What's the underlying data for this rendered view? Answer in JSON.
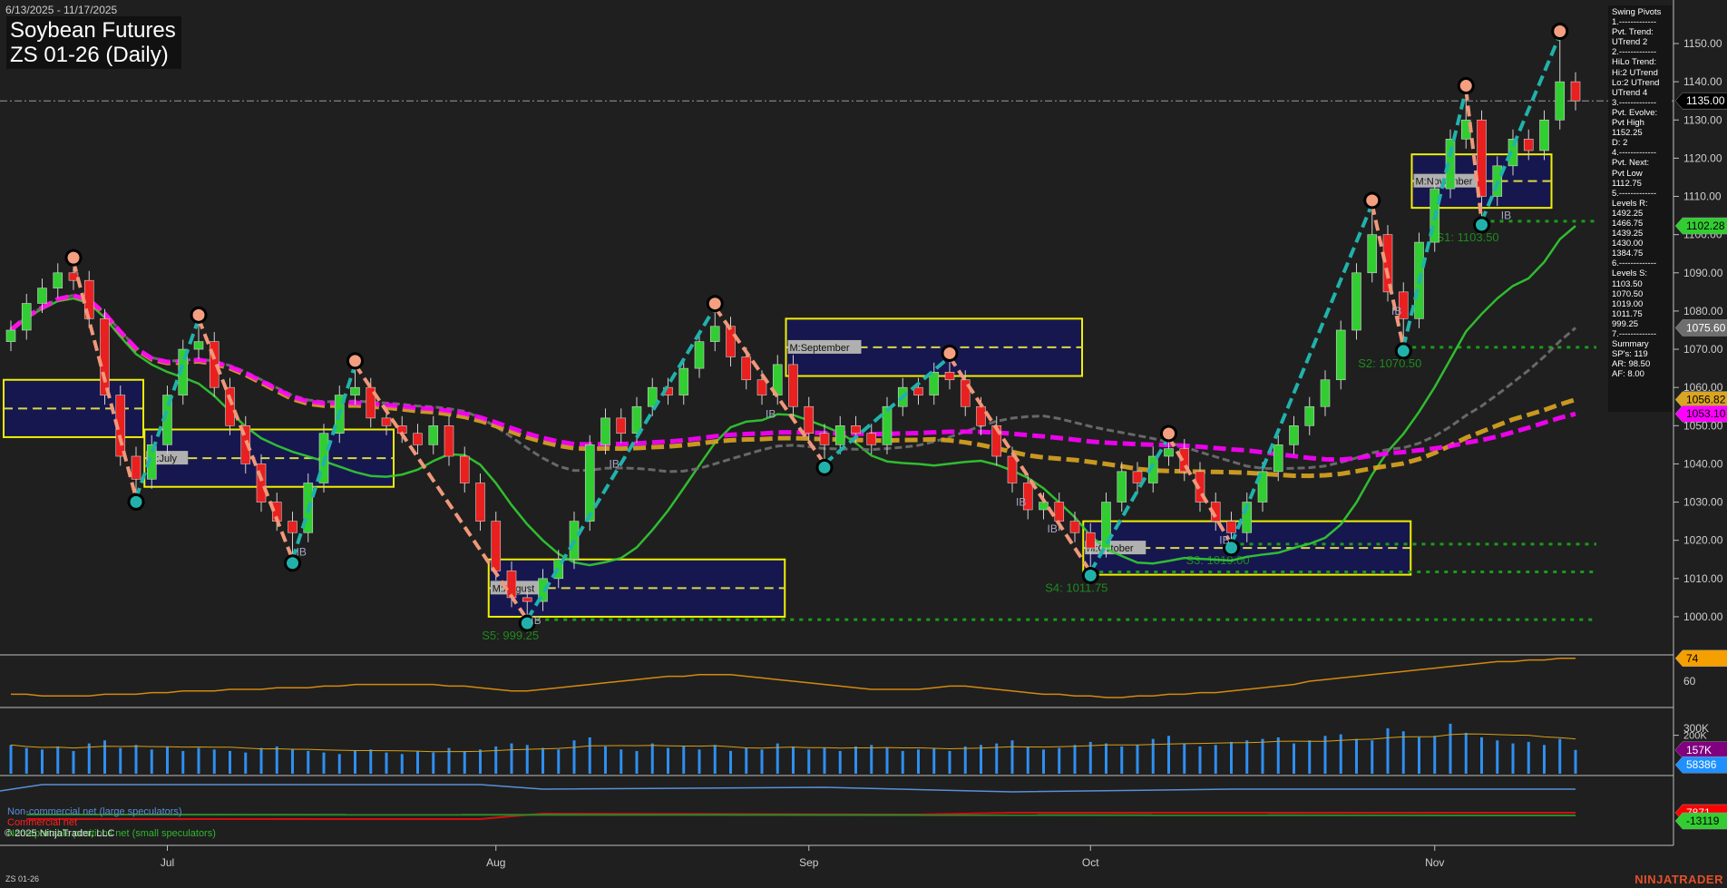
{
  "header": {
    "date_range": "6/13/2025 - 11/17/2025",
    "title": "Soybean Futures",
    "subtitle": "ZS 01-26 (Daily)"
  },
  "info_panel": {
    "lines": [
      "Swing Pivots",
      "1.-------------",
      "Pvt. Trend:",
      "UTrend 2",
      "2.-------------",
      "HiLo Trend:",
      "Hi:2 UTrend",
      "Lo:2 UTrend",
      "UTrend 4",
      "3.-------------",
      "Pvt. Evolve:",
      "Pvt High",
      "1152.25",
      "D: 2",
      "4.-------------",
      "Pvt. Next:",
      "Pvt Low",
      "1112.75",
      "5.-------------",
      "Levels R:",
      "1492.25",
      "1466.75",
      "1439.25",
      "1430.00",
      "1384.75",
      "6.-------------",
      "Levels S:",
      "1103.50",
      "1070.50",
      "1019.00",
      "1011.75",
      "999.25",
      "7.-------------",
      "Summary",
      "SP's: 119",
      "AR: 98.50",
      "AF: 8.00"
    ]
  },
  "price_tags": [
    {
      "value": "1135.00",
      "price": 1135.0,
      "bg": "#000000",
      "fg": "#ffffff"
    },
    {
      "value": "1102.28",
      "price": 1102.28,
      "bg": "#32cd32",
      "fg": "#000000"
    },
    {
      "value": "1075.60",
      "price": 1075.6,
      "bg": "#6e6e6e",
      "fg": "#ffffff"
    },
    {
      "value": "1056.82",
      "price": 1056.82,
      "bg": "#daa520",
      "fg": "#000000"
    },
    {
      "value": "1053.10",
      "price": 1053.1,
      "bg": "#ff00ff",
      "fg": "#000000"
    }
  ],
  "indicator_panel": {
    "ticks": [
      "60"
    ],
    "tag": "74",
    "values": [
      52,
      52,
      51,
      51,
      51,
      51,
      52,
      52,
      52,
      53,
      53,
      54,
      54,
      54,
      55,
      55,
      55,
      56,
      56,
      56,
      57,
      57,
      58,
      58,
      58,
      58,
      58,
      58,
      57,
      57,
      56,
      55,
      54,
      54,
      55,
      56,
      57,
      58,
      59,
      60,
      61,
      62,
      63,
      63,
      64,
      64,
      64,
      63,
      62,
      61,
      60,
      59,
      58,
      57,
      56,
      55,
      55,
      55,
      55,
      56,
      57,
      57,
      56,
      55,
      54,
      53,
      52,
      52,
      51,
      51,
      50,
      50,
      51,
      51,
      52,
      52,
      53,
      53,
      54,
      55,
      56,
      57,
      58,
      60,
      61,
      62,
      63,
      64,
      65,
      66,
      67,
      68,
      69,
      70,
      71,
      72,
      72,
      73,
      73,
      74,
      74
    ]
  },
  "volume_panel": {
    "ticks": [
      "300K",
      "200K"
    ],
    "tags": [
      {
        "value": "157K",
        "bg": "#800080"
      },
      {
        "value": "58386",
        "bg": "#1e90ff"
      }
    ],
    "values": [
      190,
      170,
      160,
      180,
      150,
      200,
      220,
      170,
      190,
      160,
      180,
      150,
      170,
      160,
      150,
      140,
      170,
      180,
      160,
      150,
      140,
      130,
      150,
      160,
      140,
      130,
      150,
      140,
      170,
      150,
      160,
      180,
      200,
      190,
      170,
      160,
      220,
      240,
      180,
      160,
      150,
      200,
      170,
      180,
      160,
      190,
      150,
      170,
      160,
      200,
      180,
      160,
      170,
      150,
      180,
      190,
      170,
      150,
      160,
      170,
      150,
      180,
      190,
      200,
      220,
      180,
      160,
      170,
      190,
      210,
      200,
      180,
      190,
      230,
      250,
      200,
      180,
      190,
      210,
      220,
      230,
      240,
      200,
      220,
      250,
      260,
      230,
      220,
      300,
      280,
      240,
      250,
      330,
      270,
      240,
      220,
      200,
      210,
      190,
      230,
      157
    ]
  },
  "cot_panel": {
    "legend": [
      {
        "label": "Non-commercial net (large speculators)",
        "color": "#5b8fd9"
      },
      {
        "label": "Commercial net",
        "color": "#ff2020"
      },
      {
        "label": "Nonreportable positions net (small speculators)",
        "color": "#2eb82e"
      }
    ],
    "tags": [
      {
        "value": "7871",
        "bg": "#ff0000"
      },
      {
        "value": "-13119",
        "bg": "#32cd32"
      }
    ]
  },
  "time_axis": {
    "labels": [
      {
        "text": "Jul",
        "index": 10
      },
      {
        "text": "Aug",
        "index": 31
      },
      {
        "text": "Sep",
        "index": 51
      },
      {
        "text": "Oct",
        "index": 69
      },
      {
        "text": "Nov",
        "index": 91
      }
    ]
  },
  "footer": {
    "copyright": "© 2025 NinjaTrader, LLC",
    "symbol": "ZS 01-26",
    "brand": "NINJATRADER"
  },
  "chart_data": {
    "type": "candlestick",
    "title": "Soybean Futures ZS 01-26 (Daily)",
    "ylim": [
      990,
      1160
    ],
    "yticks": [
      1000,
      1010,
      1020,
      1030,
      1040,
      1050,
      1060,
      1070,
      1080,
      1090,
      1100,
      1110,
      1120,
      1130,
      1140,
      1150
    ],
    "last_price": 1135.0,
    "close": [
      1075,
      1082,
      1086,
      1090,
      1088,
      1078,
      1058,
      1042,
      1036,
      1045,
      1058,
      1070,
      1072,
      1060,
      1050,
      1040,
      1030,
      1025,
      1022,
      1035,
      1048,
      1058,
      1060,
      1052,
      1050,
      1048,
      1045,
      1050,
      1042,
      1035,
      1025,
      1012,
      1005,
      1004,
      1010,
      1015,
      1025,
      1045,
      1052,
      1048,
      1055,
      1060,
      1058,
      1065,
      1072,
      1076,
      1068,
      1062,
      1058,
      1066,
      1055,
      1048,
      1045,
      1050,
      1048,
      1045,
      1055,
      1060,
      1058,
      1064,
      1062,
      1055,
      1050,
      1042,
      1035,
      1028,
      1030,
      1025,
      1022,
      1018,
      1030,
      1038,
      1035,
      1042,
      1044,
      1038,
      1030,
      1025,
      1022,
      1030,
      1038,
      1045,
      1050,
      1055,
      1062,
      1075,
      1090,
      1100,
      1085,
      1078,
      1098,
      1112,
      1125,
      1130,
      1110,
      1118,
      1125,
      1122,
      1130,
      1140,
      1135
    ],
    "pivots": [
      {
        "index": 4,
        "price": 1093,
        "type": "high"
      },
      {
        "index": 8,
        "price": 1031,
        "type": "low"
      },
      {
        "index": 12,
        "price": 1078,
        "type": "high"
      },
      {
        "index": 18,
        "price": 1015,
        "type": "low"
      },
      {
        "index": 22,
        "price": 1066,
        "type": "high"
      },
      {
        "index": 33,
        "price": 999.25,
        "type": "low"
      },
      {
        "index": 45,
        "price": 1081,
        "type": "high"
      },
      {
        "index": 52,
        "price": 1040,
        "type": "low"
      },
      {
        "index": 60,
        "price": 1068,
        "type": "high"
      },
      {
        "index": 69,
        "price": 1011.75,
        "type": "low"
      },
      {
        "index": 74,
        "price": 1047,
        "type": "high"
      },
      {
        "index": 78,
        "price": 1019,
        "type": "low"
      },
      {
        "index": 87,
        "price": 1108,
        "type": "high"
      },
      {
        "index": 89,
        "price": 1070.5,
        "type": "low"
      },
      {
        "index": 93,
        "price": 1138,
        "type": "high"
      },
      {
        "index": 94,
        "price": 1103.5,
        "type": "low"
      },
      {
        "index": 99,
        "price": 1152.25,
        "type": "high"
      }
    ],
    "support_levels": [
      {
        "label": "S1: 1103.50",
        "price": 1103.5,
        "from": 94
      },
      {
        "label": "S2: 1070.50",
        "price": 1070.5,
        "from": 89
      },
      {
        "label": "S3: 1019.00",
        "price": 1019.0,
        "from": 78
      },
      {
        "label": "S4: 1011.75",
        "price": 1011.75,
        "from": 69
      },
      {
        "label": "S5: 999.25",
        "price": 999.25,
        "from": 33
      }
    ],
    "month_boxes": [
      {
        "label": "",
        "start": 0,
        "end": 8,
        "high": 1062,
        "low": 1047
      },
      {
        "label": "M:July",
        "start": 9,
        "end": 24,
        "high": 1049,
        "low": 1034
      },
      {
        "label": "M:August",
        "start": 31,
        "end": 49,
        "high": 1015,
        "low": 1000
      },
      {
        "label": "M:September",
        "start": 50,
        "end": 68,
        "high": 1078,
        "low": 1063
      },
      {
        "label": "M:October",
        "start": 69,
        "end": 89,
        "high": 1025,
        "low": 1011
      },
      {
        "label": "M:November",
        "start": 90,
        "end": 98,
        "high": 1121,
        "low": 1107
      }
    ],
    "ib_markers": [
      {
        "text": "IB",
        "index": 18
      },
      {
        "text": "IB",
        "index": 33
      },
      {
        "text": "IB",
        "index": 38
      },
      {
        "text": "IB",
        "index": 48
      },
      {
        "text": "IB",
        "index": 64
      },
      {
        "text": "IB",
        "index": 66
      },
      {
        "text": "IB",
        "index": 77
      },
      {
        "text": "IB",
        "index": 88
      },
      {
        "text": "IB",
        "index": 95
      }
    ],
    "moving_averages": [
      {
        "name": "fast",
        "color": "#32cd32",
        "last": 1102.28
      },
      {
        "name": "mid",
        "color": "#707070",
        "last": 1075.6
      },
      {
        "name": "slow",
        "color": "#daa520",
        "last": 1056.82
      },
      {
        "name": "slowest",
        "color": "#ff00ff",
        "last": 1053.1
      }
    ]
  }
}
